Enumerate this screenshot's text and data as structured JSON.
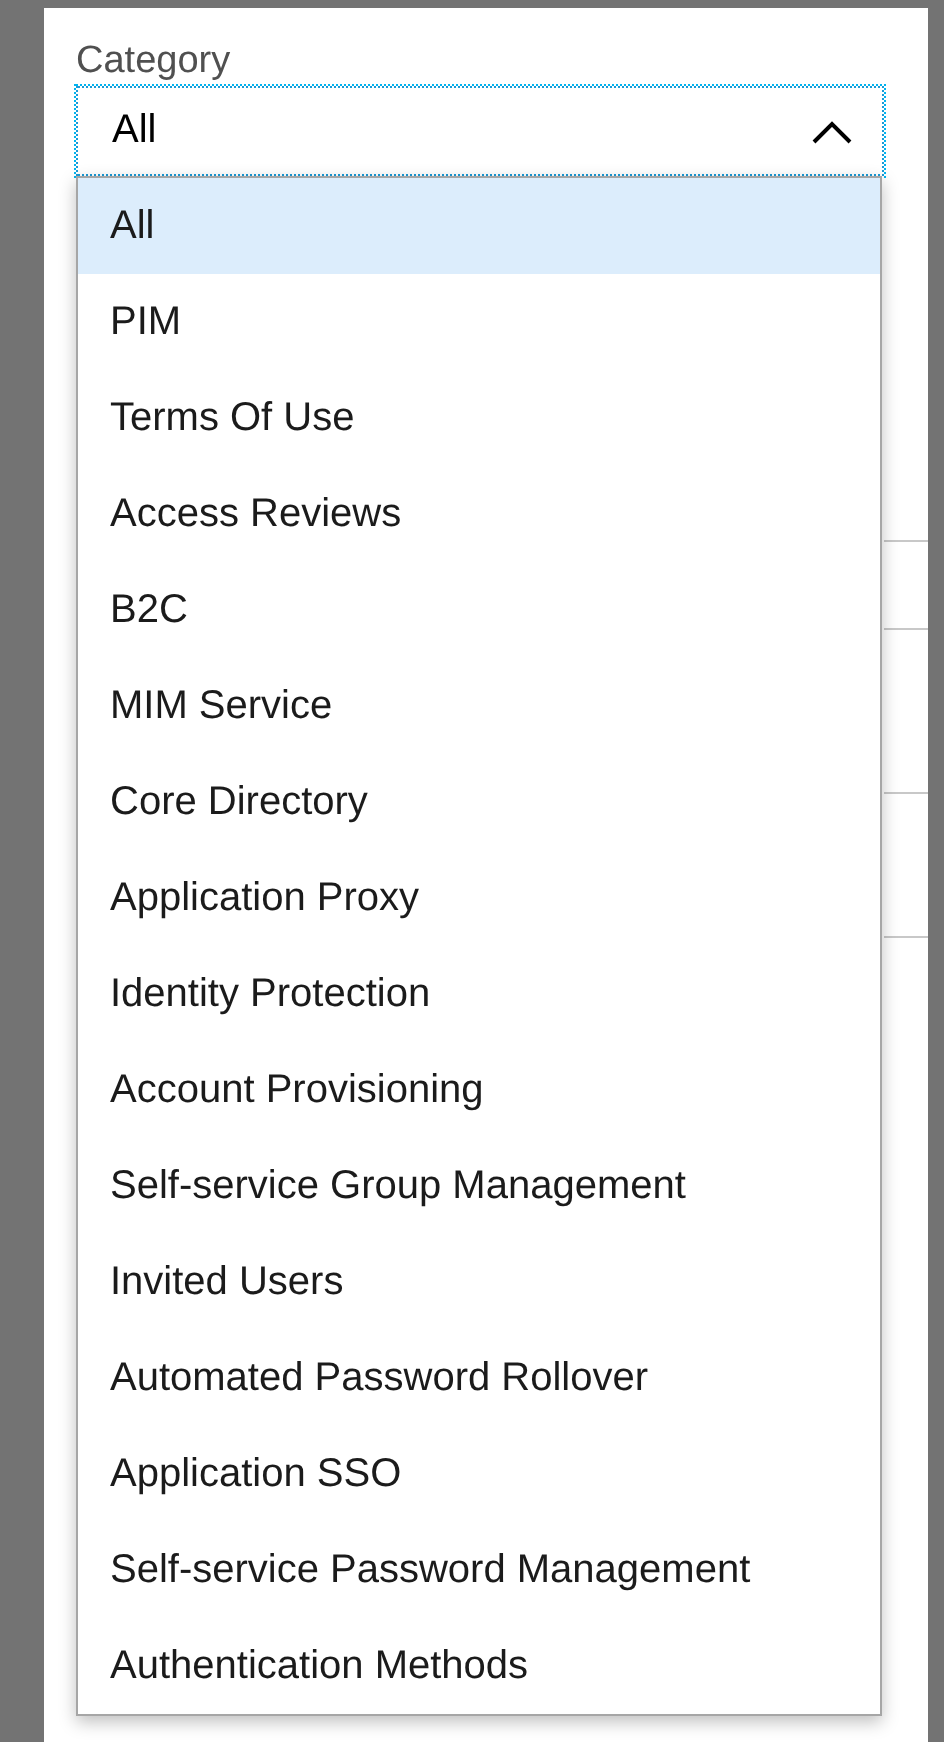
{
  "field": {
    "label": "Category",
    "value": "All",
    "expanded": true
  },
  "options": [
    {
      "label": "All",
      "selected": true
    },
    {
      "label": "PIM",
      "selected": false
    },
    {
      "label": "Terms Of Use",
      "selected": false
    },
    {
      "label": "Access Reviews",
      "selected": false
    },
    {
      "label": "B2C",
      "selected": false
    },
    {
      "label": "MIM Service",
      "selected": false
    },
    {
      "label": "Core Directory",
      "selected": false
    },
    {
      "label": "Application Proxy",
      "selected": false
    },
    {
      "label": "Identity Protection",
      "selected": false
    },
    {
      "label": "Account Provisioning",
      "selected": false
    },
    {
      "label": "Self-service Group Management",
      "selected": false
    },
    {
      "label": "Invited Users",
      "selected": false
    },
    {
      "label": "Automated Password Rollover",
      "selected": false
    },
    {
      "label": "Application SSO",
      "selected": false
    },
    {
      "label": "Self-service Password Management",
      "selected": false
    },
    {
      "label": "Authentication Methods",
      "selected": false
    }
  ]
}
